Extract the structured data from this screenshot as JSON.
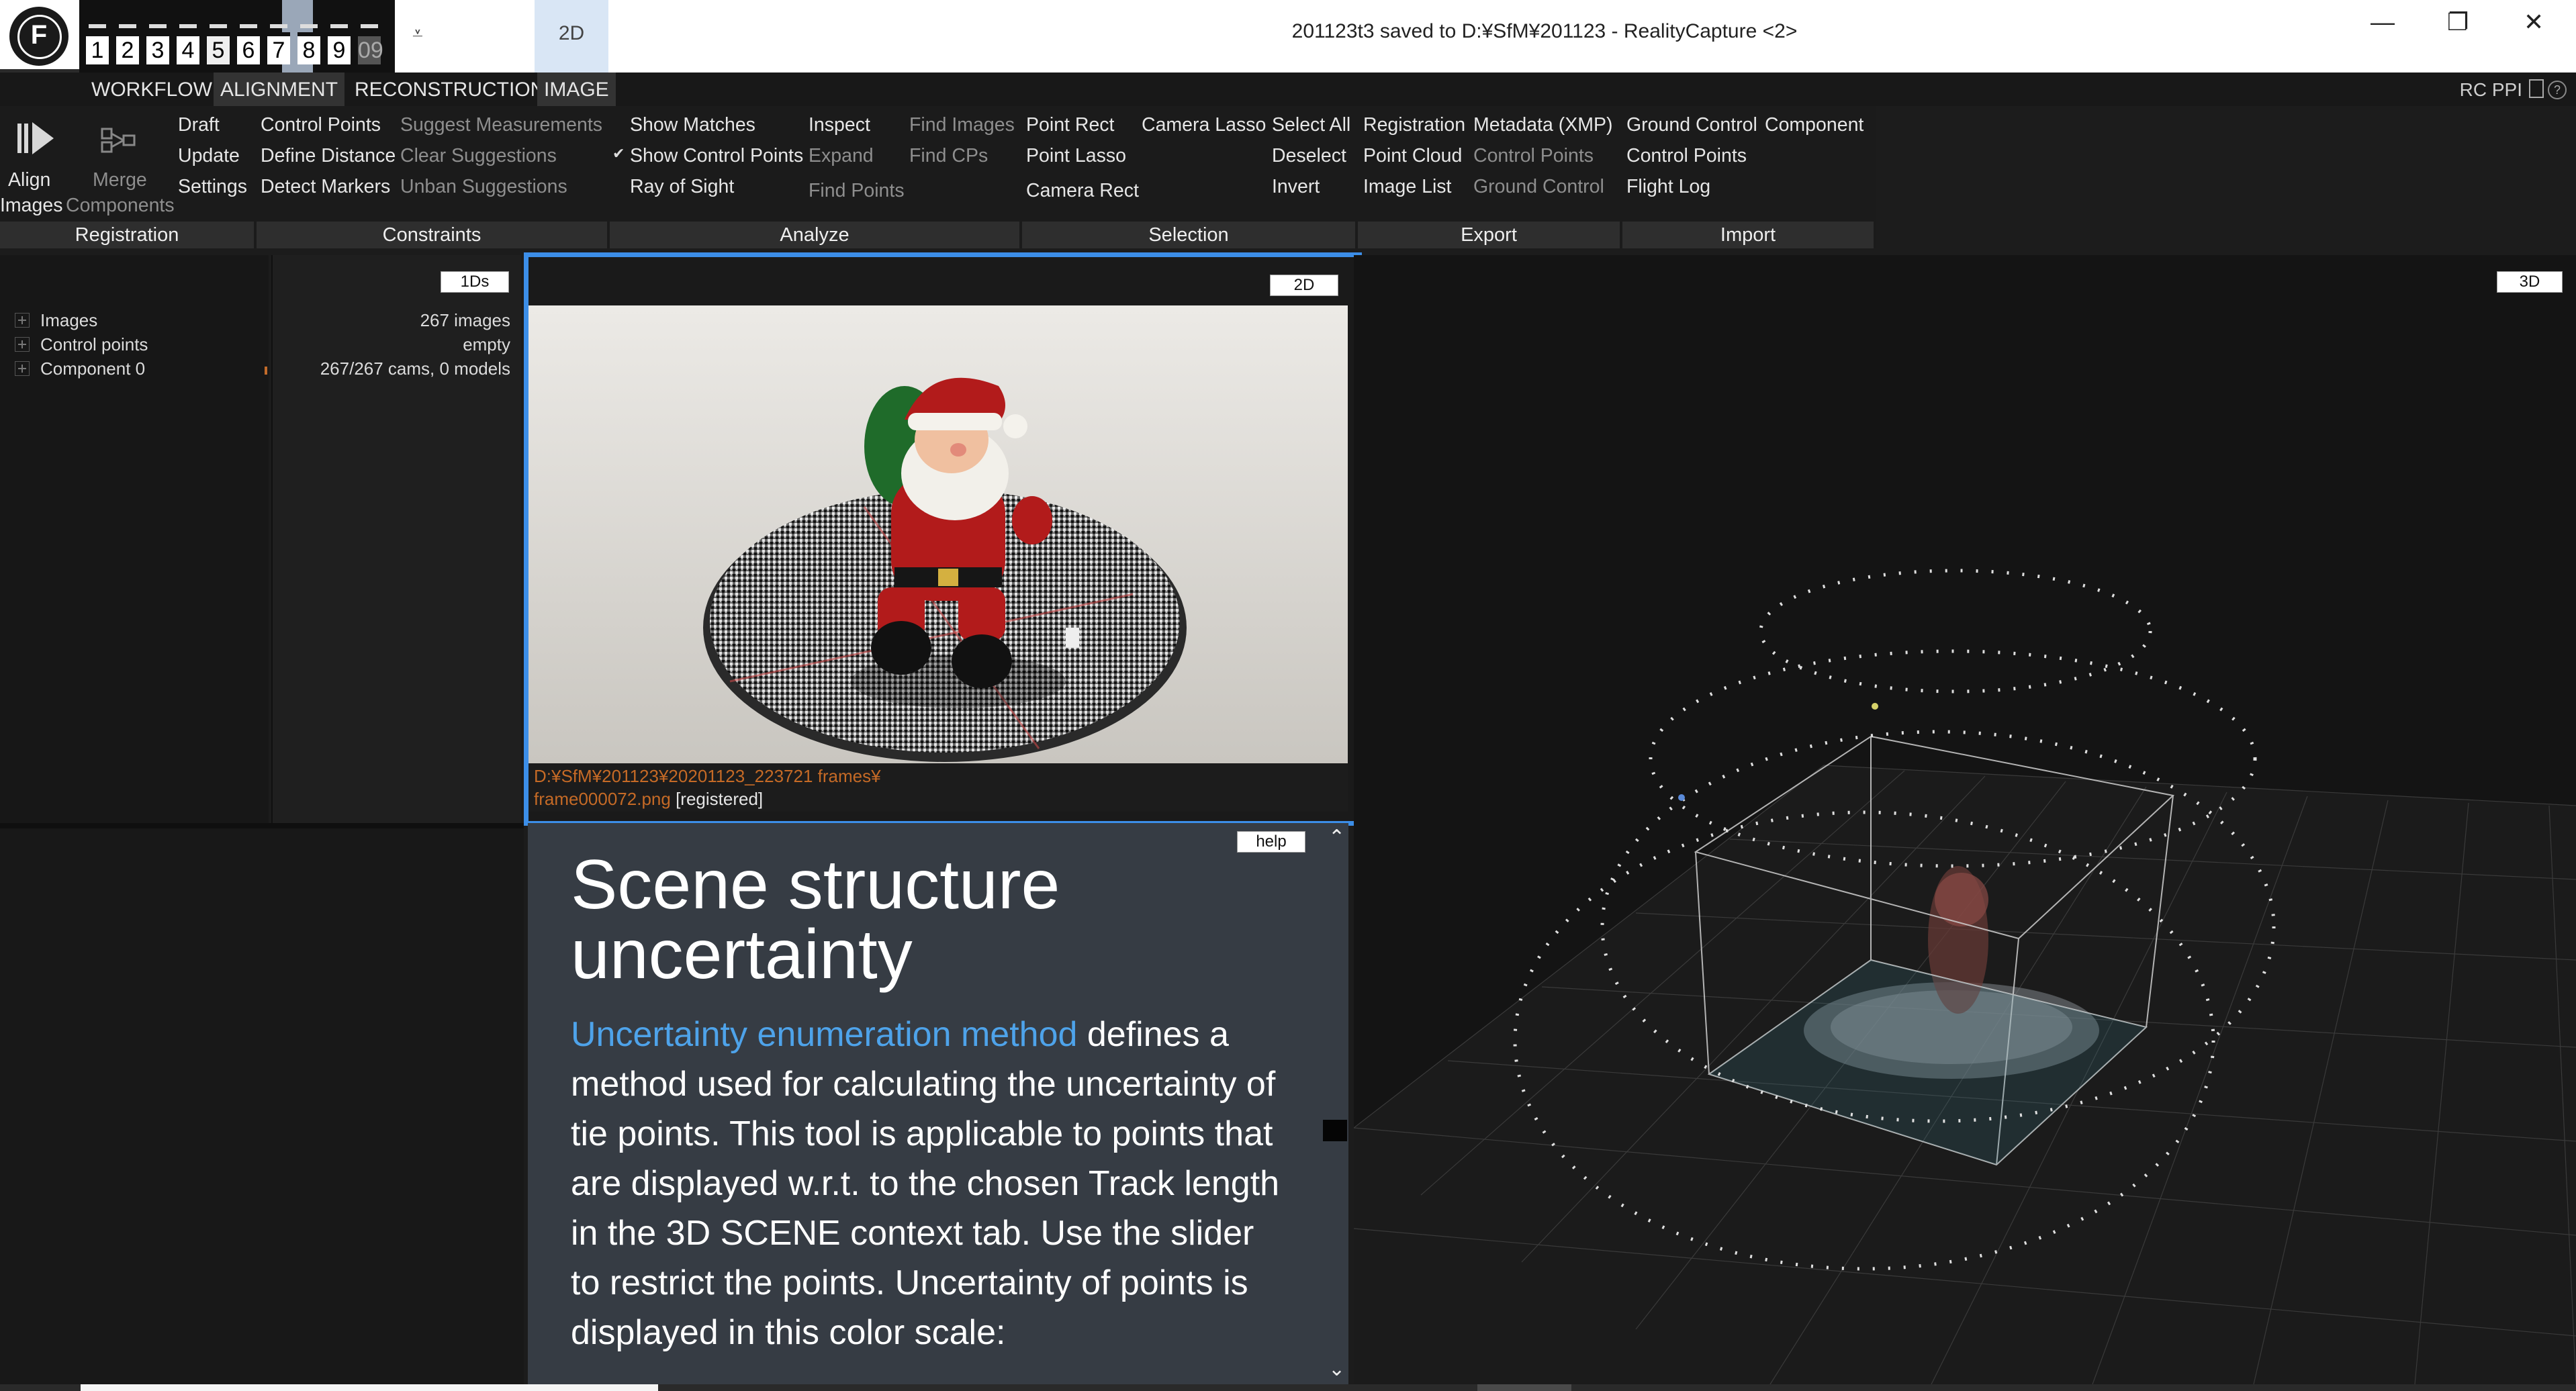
{
  "app": {
    "logo_letter": "F",
    "window_title": "201123t3 saved to D:¥SfM¥201123 - RealityCapture <2>",
    "layout_tabs": [
      "1",
      "2",
      "3",
      "4",
      "5",
      "6",
      "7",
      "8",
      "9",
      "09"
    ],
    "layout_active": "5",
    "view_tab_2d": "2D",
    "dropdown_glyph": "⩡",
    "win_minimize": "—",
    "win_restore": "❐",
    "win_close": "✕"
  },
  "menu": {
    "tabs": [
      "WORKFLOW",
      "ALIGNMENT",
      "RECONSTRUCTION",
      "IMAGE"
    ],
    "active": "ALIGNMENT",
    "right_label": "RC PPI"
  },
  "ribbon": {
    "align_images_1": "Align",
    "align_images_2": "Images",
    "merge_components_1": "Merge",
    "merge_components_2": "Components",
    "registration": [
      "Draft",
      "Update",
      "Settings"
    ],
    "constraints_col1": [
      "Control Points",
      "Define Distance",
      "Detect Markers"
    ],
    "constraints_col2": [
      "Suggest Measurements",
      "Clear Suggestions",
      "Unban Suggestions"
    ],
    "analyze_col1": [
      "Show Matches",
      "Show Control Points",
      "Ray of Sight"
    ],
    "analyze_col2": [
      "Inspect",
      "Expand",
      "Find Points"
    ],
    "analyze_col3": [
      "Find Images",
      "Find CPs"
    ],
    "selection_col1": [
      "Point Rect",
      "Point Lasso",
      "Camera Rect"
    ],
    "selection_col2": [
      "Camera Lasso"
    ],
    "selection_col3": [
      "Select All",
      "Deselect",
      "Invert"
    ],
    "export_col1": [
      "Registration",
      "Point Cloud",
      "Image List"
    ],
    "export_col2": [
      "Metadata (XMP)",
      "Control Points",
      "Ground Control"
    ],
    "import_col1": [
      "Ground Control",
      "Control Points",
      "Flight Log"
    ],
    "import_col2": [
      "Component"
    ],
    "groups": [
      "Registration",
      "Constraints",
      "Analyze",
      "Selection",
      "Export",
      "Import"
    ]
  },
  "tree": {
    "items": [
      "Images",
      "Control points",
      "Component 0"
    ],
    "values": [
      "267 images",
      "empty",
      "267/267 cams, 0 models"
    ],
    "badge": "1Ds"
  },
  "view2d": {
    "badge": "2D",
    "path_line1": "D:¥SfM¥201123¥20201123_223721 frames¥",
    "path_line2": "frame000072.png",
    "status": "[registered]"
  },
  "help": {
    "badge": "help",
    "title": "Scene structure uncertainty",
    "link": "Uncertainty enumeration method",
    "body": " defines a method used for calculating the uncertainty of tie points. This tool is applicable to points that are displayed w.r.t. to the chosen Track length in the 3D SCENE context tab. Use the slider to restrict the points. Uncertainty of points is displayed in this color scale:",
    "scroll_up": "⌃",
    "scroll_down": "⌄"
  },
  "view3d": {
    "badge": "3D"
  },
  "colors": {
    "accent_blue": "#3c8ee8",
    "link_blue": "#4ea3ea",
    "path_orange": "#c56a26",
    "help_bg": "#363c44"
  }
}
